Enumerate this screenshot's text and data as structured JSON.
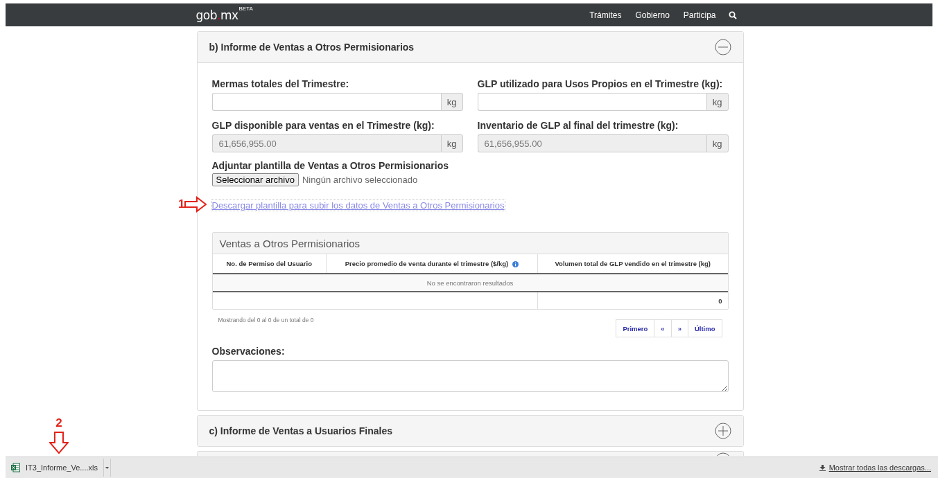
{
  "nav": {
    "logo": "gob",
    "logo_dot": ".",
    "logo_suffix": "mx",
    "badge": "BETA",
    "links": [
      "Trámites",
      "Gobierno",
      "Participa"
    ]
  },
  "panels": [
    {
      "title": "b) Informe de Ventas a Otros Permisionarios",
      "expanded": true
    },
    {
      "title": "c) Informe de Ventas a Usuarios Finales",
      "expanded": false
    },
    {
      "expanded": false
    }
  ],
  "form": {
    "fields": [
      {
        "label": "Mermas totales del Trimestre:",
        "unit": "kg",
        "disabled": false
      },
      {
        "label": "GLP utilizado para Usos Propios en el Trimestre (kg):",
        "unit": "kg",
        "disabled": false
      },
      {
        "label": "GLP disponible para ventas en el Trimestre (kg):",
        "value": "61,656,955.00",
        "unit": "kg",
        "disabled": true
      },
      {
        "label": "Inventario de GLP al final del trimestre (kg):",
        "value": "61,656,955.00",
        "unit": "kg",
        "disabled": true
      }
    ],
    "attachment": {
      "label": "Adjuntar plantilla de Ventas a Otros Permisionarios",
      "button": "Seleccionar archivo",
      "status": "Ningún archivo seleccionado"
    },
    "template_link": "Descargar plantilla para subir los datos de Ventas a Otros Permisionarios",
    "table": {
      "title": "Ventas a Otros Permisionarios",
      "columns": [
        "No. de Permiso del Usuario",
        "Precio promedio de venta durante el trimestre ($/kg)",
        "Volumen total de GLP vendido en el trimestre (kg)"
      ],
      "empty_message": "No se encontraron resultados",
      "total": "0",
      "info": "Mostrando del 0 al 0 de un total de 0",
      "pagination": [
        "Primero",
        "«",
        "»",
        "Último"
      ]
    },
    "observations": {
      "label": "Observaciones:"
    }
  },
  "downloads": {
    "file": "IT3_Informe_Ve....xls",
    "show_all": "Mostrar todas las descargas..."
  },
  "annotations": [
    {
      "label": "1",
      "kind": "arrow-right"
    },
    {
      "label": "2",
      "kind": "arrow-down"
    }
  ]
}
